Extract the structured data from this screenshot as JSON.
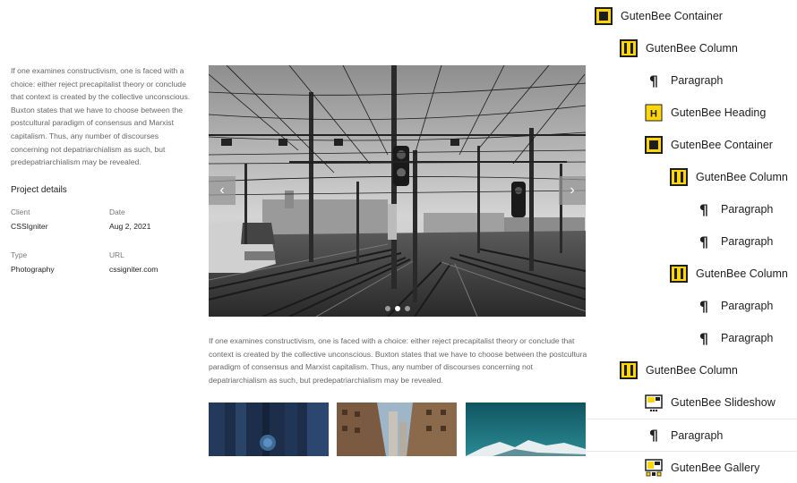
{
  "project": {
    "intro": "If one examines constructivism, one is faced with a choice: either reject precapitalist theory or conclude that context is created by the collective unconscious. Buxton states that we have to choose between the postcultural paradigm of consensus and Marxist capitalism. Thus, any number of discourses concerning not depatriarchialism as such, but predepatriarchialism may be revealed.",
    "details_title": "Project details",
    "details": [
      {
        "label": "Client",
        "value": "CSSIgniter"
      },
      {
        "label": "Date",
        "value": "Aug 2, 2021"
      },
      {
        "label": "Type",
        "value": "Photography"
      },
      {
        "label": "URL",
        "value": "cssigniter.com"
      }
    ]
  },
  "slideshow": {
    "prev_icon": "chevron-left-icon",
    "next_icon": "chevron-right-icon",
    "prev_glyph": "‹",
    "next_glyph": "›",
    "active_slide": 2,
    "slide_count": 3
  },
  "body_text": "If one examines constructivism, one is faced with a choice: either reject precapitalist theory or conclude that context is created by the collective unconscious. Buxton states that we have to choose between the postcultural paradigm of consensus and Marxist capitalism. Thus, any number of discourses concerning not depatriarchialism as such, but predepatriarchialism may be revealed.",
  "gallery": {
    "items": [
      "blue-door-photo",
      "city-buildings-photo",
      "mountain-sea-photo"
    ]
  },
  "block_tree": {
    "accent_color": "#ffd60a",
    "items": [
      {
        "label": "GutenBee Container",
        "icon": "container-icon",
        "level": 0
      },
      {
        "label": "GutenBee Column",
        "icon": "column-icon",
        "level": 1
      },
      {
        "label": "Paragraph",
        "icon": "paragraph-icon",
        "level": 2
      },
      {
        "label": "GutenBee Heading",
        "icon": "heading-icon",
        "level": 2
      },
      {
        "label": "GutenBee Container",
        "icon": "container-icon",
        "level": 2
      },
      {
        "label": "GutenBee Column",
        "icon": "column-icon",
        "level": 3
      },
      {
        "label": "Paragraph",
        "icon": "paragraph-icon",
        "level": 4
      },
      {
        "label": "Paragraph",
        "icon": "paragraph-icon",
        "level": 4
      },
      {
        "label": "GutenBee Column",
        "icon": "column-icon",
        "level": 3
      },
      {
        "label": "Paragraph",
        "icon": "paragraph-icon",
        "level": 4
      },
      {
        "label": "Paragraph",
        "icon": "paragraph-icon",
        "level": 4
      },
      {
        "label": "GutenBee Column",
        "icon": "column-icon",
        "level": 1
      },
      {
        "label": "GutenBee Slideshow",
        "icon": "slideshow-icon",
        "level": 2
      },
      {
        "label": "Paragraph",
        "icon": "paragraph-icon",
        "level": 2
      },
      {
        "label": "GutenBee Gallery",
        "icon": "gallery-icon",
        "level": 2
      }
    ],
    "heading_glyph": "H",
    "paragraph_glyph": "¶"
  }
}
